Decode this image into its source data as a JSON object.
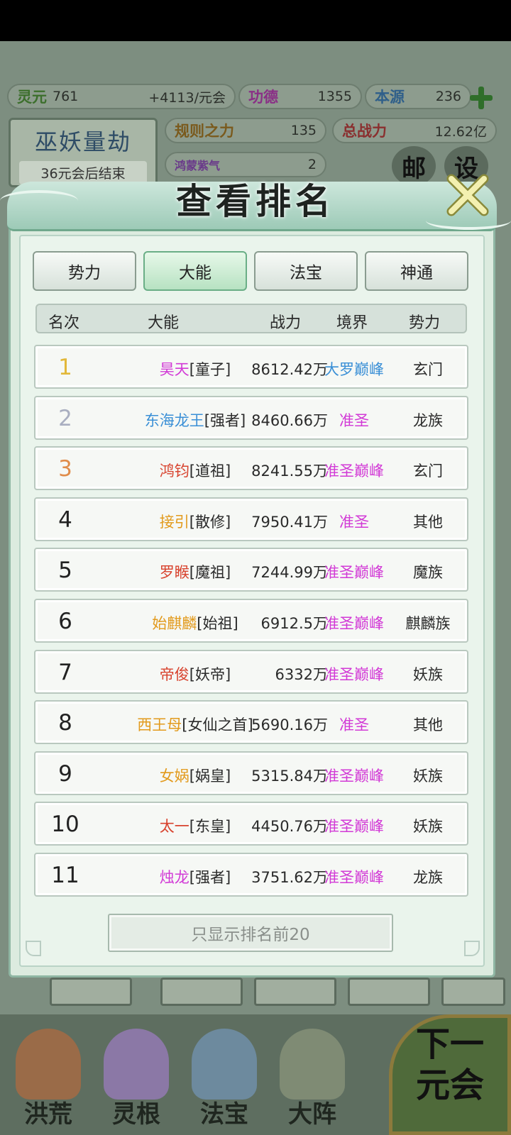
{
  "background": {
    "stats": {
      "lingyuan_label": "灵元",
      "lingyuan_value": "761",
      "rate": "+4113/元会",
      "gongde_label": "功德",
      "gongde_value": "1355",
      "benyuan_label": "本源",
      "benyuan_value": "236",
      "guize_label": "规则之力",
      "guize_value": "135",
      "zongzhanli_label": "总战力",
      "zongzhanli_value": "12.62亿",
      "hongmeng_label": "鸿蒙紫气",
      "hongmeng_value": "2"
    },
    "event": {
      "title": "巫妖量劫",
      "subtitle": "36元会后结束"
    },
    "corner_buttons": [
      "邮",
      "设"
    ],
    "nav": [
      "洪荒",
      "灵根",
      "法宝",
      "大阵"
    ],
    "next_button": [
      "下一",
      "元会"
    ]
  },
  "dialog": {
    "title": "查看排名",
    "tabs": [
      "势力",
      "大能",
      "法宝",
      "神通"
    ],
    "active_tab": "大能",
    "columns": {
      "rank": "名次",
      "name": "大能",
      "power": "战力",
      "realm": "境界",
      "faction": "势力"
    },
    "rows": [
      {
        "rank": "1",
        "name": "昊天",
        "title": "[童子]",
        "power": "8612.42万",
        "realm": "大罗巅峰",
        "faction": "玄门",
        "name_color": "#d23ad6",
        "realm_color": "#3a8fd6"
      },
      {
        "rank": "2",
        "name": "东海龙王",
        "title": "[强者]",
        "power": "8460.66万",
        "realm": "准圣",
        "faction": "龙族",
        "name_color": "#3a8fd6",
        "realm_color": "#d23ad6"
      },
      {
        "rank": "3",
        "name": "鸿钧",
        "title": "[道祖]",
        "power": "8241.55万",
        "realm": "准圣巅峰",
        "faction": "玄门",
        "name_color": "#d8432e",
        "realm_color": "#d23ad6"
      },
      {
        "rank": "4",
        "name": "接引",
        "title": "[散修]",
        "power": "7950.41万",
        "realm": "准圣",
        "faction": "其他",
        "name_color": "#e29a1c",
        "realm_color": "#d23ad6"
      },
      {
        "rank": "5",
        "name": "罗睺",
        "title": "[魔祖]",
        "power": "7244.99万",
        "realm": "准圣巅峰",
        "faction": "魔族",
        "name_color": "#d8432e",
        "realm_color": "#d23ad6"
      },
      {
        "rank": "6",
        "name": "始麒麟",
        "title": "[始祖]",
        "power": "6912.5万",
        "realm": "准圣巅峰",
        "faction": "麒麟族",
        "name_color": "#e29a1c",
        "realm_color": "#d23ad6"
      },
      {
        "rank": "7",
        "name": "帝俊",
        "title": "[妖帝]",
        "power": "6332万",
        "realm": "准圣巅峰",
        "faction": "妖族",
        "name_color": "#d8432e",
        "realm_color": "#d23ad6"
      },
      {
        "rank": "8",
        "name": "西王母",
        "title": "[女仙之首]",
        "power": "5690.16万",
        "realm": "准圣",
        "faction": "其他",
        "name_color": "#e29a1c",
        "realm_color": "#d23ad6"
      },
      {
        "rank": "9",
        "name": "女娲",
        "title": "[娲皇]",
        "power": "5315.84万",
        "realm": "准圣巅峰",
        "faction": "妖族",
        "name_color": "#e29a1c",
        "realm_color": "#d23ad6"
      },
      {
        "rank": "10",
        "name": "太一",
        "title": "[东皇]",
        "power": "4450.76万",
        "realm": "准圣巅峰",
        "faction": "妖族",
        "name_color": "#d8432e",
        "realm_color": "#d23ad6"
      },
      {
        "rank": "11",
        "name": "烛龙",
        "title": "[强者]",
        "power": "3751.62万",
        "realm": "准圣巅峰",
        "faction": "龙族",
        "name_color": "#d23ad6",
        "realm_color": "#d23ad6"
      }
    ],
    "show_top_button": "只显示排名前20"
  },
  "colors": {
    "accent_green": "#6aae86",
    "dialog_bg": "#eaf4ec",
    "magenta": "#d23ad6",
    "blue": "#3a8fd6"
  }
}
